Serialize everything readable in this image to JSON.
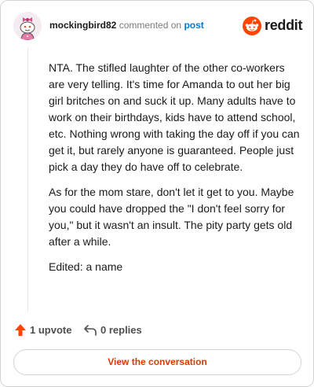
{
  "header": {
    "username": "mockingbird82",
    "action_text": "commented on",
    "post_link": "post",
    "logo_text": "reddit"
  },
  "comment": {
    "paragraphs": [
      "NTA. The stifled laughter of the other co-workers are very telling. It's time for Amanda to out her big girl britches on and suck it up. Many adults have to work on their birthdays, kids have to attend school, etc. Nothing wrong with taking the day off if you can get it, but rarely anyone is guaranteed. People just pick a day they do have off to celebrate.",
      "As for the mom stare, don't let it get to you. Maybe you could have dropped the \"I don't feel sorry for you,\" but it wasn't an insult. The pity party gets old after a while.",
      "Edited: a name"
    ]
  },
  "actions": {
    "upvote_label": "1 upvote",
    "replies_label": "0 replies"
  },
  "button": {
    "view_label": "View the conversation"
  },
  "colors": {
    "brand": "#ff4500",
    "link": "#0079d3",
    "button_text": "#d93a00"
  },
  "icons": {
    "avatar": "snoo-avatar",
    "logo": "reddit-snoo-icon",
    "upvote": "upvote-arrow-icon",
    "reply": "reply-arrow-icon"
  }
}
